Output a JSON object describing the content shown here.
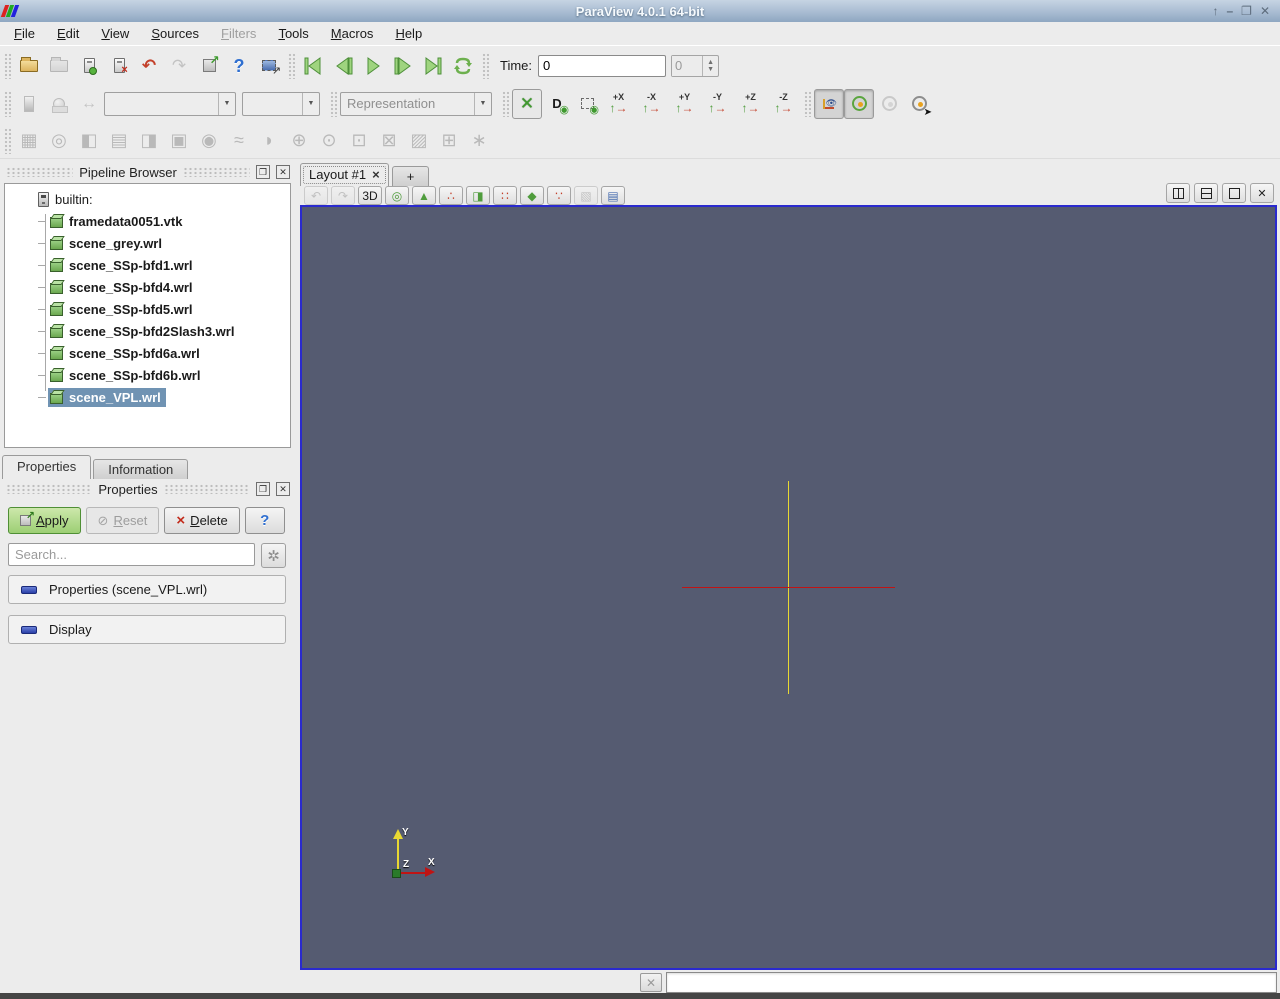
{
  "window": {
    "title": "ParaView 4.0.1 64-bit",
    "controls": {
      "shade": "↑",
      "minimize": "–",
      "restore": "❐",
      "close": "✕"
    }
  },
  "menubar": {
    "items": [
      {
        "label": "File",
        "state": ""
      },
      {
        "label": "Edit",
        "state": ""
      },
      {
        "label": "View",
        "state": ""
      },
      {
        "label": "Sources",
        "state": ""
      },
      {
        "label": "Filters",
        "state": "disabled"
      },
      {
        "label": "Tools",
        "state": ""
      },
      {
        "label": "Macros",
        "state": ""
      },
      {
        "label": "Help",
        "state": ""
      }
    ]
  },
  "toolbar_main": {
    "undo_glyph": "↶",
    "redo_glyph": "↷",
    "help_glyph": "?",
    "time_label": "Time:",
    "time_value": "0",
    "frame_value": "0"
  },
  "toolbar_display": {
    "rescale_glyph": "↔",
    "variable_value": "",
    "component_value": "",
    "representation_value": "Representation",
    "reset_camera_glyph": "✕",
    "zoom_data_label": "D",
    "camera_buttons": [
      {
        "label": "+X"
      },
      {
        "label": "-X"
      },
      {
        "label": "+Y"
      },
      {
        "label": "-Y"
      },
      {
        "label": "+Z"
      },
      {
        "label": "-Z"
      }
    ]
  },
  "filters_toolbar": {
    "icons": [
      {
        "name": "calculator-filter-icon",
        "glyph": "▦"
      },
      {
        "name": "contour-filter-icon",
        "glyph": "◎"
      },
      {
        "name": "clip-filter-icon",
        "glyph": "◧"
      },
      {
        "name": "slice-filter-icon",
        "glyph": "▤"
      },
      {
        "name": "threshold-filter-icon",
        "glyph": "◨"
      },
      {
        "name": "extract-subset-filter-icon",
        "glyph": "▣"
      },
      {
        "name": "glyph-filter-icon",
        "glyph": "◉"
      },
      {
        "name": "stream-tracer-filter-icon",
        "glyph": "≈"
      },
      {
        "name": "warp-by-vector-filter-icon",
        "glyph": "◗"
      },
      {
        "name": "group-datasets-filter-icon",
        "glyph": "⊕"
      },
      {
        "name": "extract-group-filter-icon",
        "glyph": "⊙"
      },
      {
        "name": "extract-selection-filter-icon",
        "glyph": "⊡"
      },
      {
        "name": "plot-over-time-filter-icon",
        "glyph": "⊠"
      },
      {
        "name": "plot-over-line-filter-icon",
        "glyph": "▨"
      },
      {
        "name": "plot-selection-over-time-filter-icon",
        "glyph": "⊞"
      },
      {
        "name": "probe-location-filter-icon",
        "glyph": "∗"
      }
    ]
  },
  "pipeline": {
    "dock_title": "Pipeline Browser",
    "root_label": "builtin:",
    "items": [
      {
        "label": "framedata0051.vtk",
        "state": ""
      },
      {
        "label": "scene_grey.wrl",
        "state": ""
      },
      {
        "label": "scene_SSp-bfd1.wrl",
        "state": ""
      },
      {
        "label": "scene_SSp-bfd4.wrl",
        "state": ""
      },
      {
        "label": "scene_SSp-bfd5.wrl",
        "state": ""
      },
      {
        "label": "scene_SSp-bfd2Slash3.wrl",
        "state": ""
      },
      {
        "label": "scene_SSp-bfd6a.wrl",
        "state": ""
      },
      {
        "label": "scene_SSp-bfd6b.wrl",
        "state": ""
      },
      {
        "label": "scene_VPL.wrl",
        "state": "selected"
      }
    ]
  },
  "properties_panel": {
    "tabs": [
      {
        "label": "Properties",
        "state": "active"
      },
      {
        "label": "Information",
        "state": "inactive"
      }
    ],
    "dock_title": "Properties",
    "apply_label": "Apply",
    "reset_label": "Reset",
    "reset_glyph": "⊘",
    "delete_label": "Delete",
    "delete_glyph": "×",
    "help_glyph": "?",
    "search_placeholder": "Search...",
    "gear_glyph": "✲",
    "sections": [
      {
        "label": "Properties (scene_VPL.wrl)"
      },
      {
        "label": "Display"
      }
    ]
  },
  "layout": {
    "tab_label": "Layout #1",
    "tab_close_glyph": "×",
    "add_tab_label": "+",
    "view_buttons": [
      {
        "name": "camera-undo-icon",
        "glyph": "↶",
        "color": "gray",
        "state": "disabled"
      },
      {
        "name": "camera-redo-icon",
        "glyph": "↷",
        "color": "gray",
        "state": "disabled"
      },
      {
        "name": "interaction-mode-3d-button",
        "glyph": "3D",
        "color": "",
        "state": ""
      },
      {
        "name": "adjust-camera-icon",
        "glyph": "◎",
        "color": "green",
        "state": ""
      },
      {
        "name": "select-cells-on-icon",
        "glyph": "▲",
        "color": "green",
        "state": ""
      },
      {
        "name": "select-points-on-icon",
        "glyph": "∴",
        "color": "red",
        "state": ""
      },
      {
        "name": "select-cells-through-icon",
        "glyph": "◨",
        "color": "green",
        "state": ""
      },
      {
        "name": "select-points-through-icon",
        "glyph": "∷",
        "color": "red",
        "state": ""
      },
      {
        "name": "select-cells-polygon-icon",
        "glyph": "◆",
        "color": "green",
        "state": ""
      },
      {
        "name": "select-points-polygon-icon",
        "glyph": "∵",
        "color": "red",
        "state": ""
      },
      {
        "name": "interactive-select-icon",
        "glyph": "▧",
        "color": "gray",
        "state": "disabled"
      },
      {
        "name": "spreadsheet-view-icon",
        "glyph": "▤",
        "color": "blue",
        "state": ""
      }
    ]
  },
  "viewport": {
    "background_color": "#555b71",
    "border_color": "#2a2ace",
    "vertical_line_color": "#e8d832",
    "horizontal_line_color": "#c01414",
    "axis_x_label": "X",
    "axis_y_label": "Y",
    "axis_z_label": "Z"
  },
  "statusbar": {
    "cancel_glyph": "✕"
  },
  "colors": {
    "titlebar_top": "#c6d4e3",
    "titlebar_bottom": "#8ea7c1",
    "selection_blue": "#7093b3",
    "apply_green": "#9ccf74",
    "toolbar_green": "#6db04e",
    "undo_red": "#c3402a"
  }
}
